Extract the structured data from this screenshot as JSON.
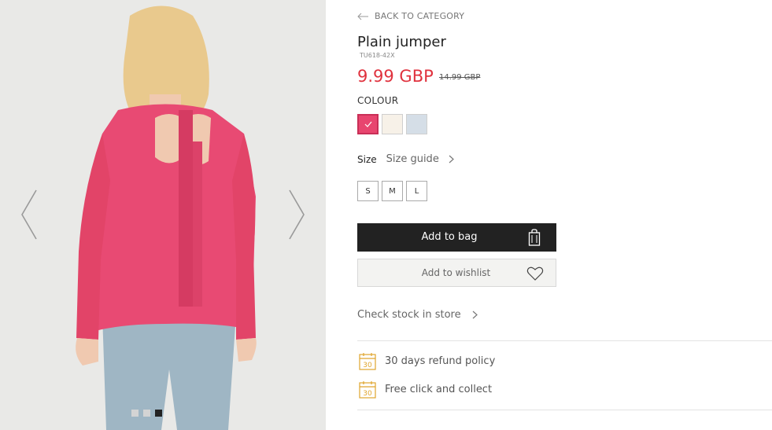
{
  "gallery": {
    "prev_label": "Previous image",
    "next_label": "Next image",
    "dot_count": 3,
    "active_dot": 3
  },
  "product": {
    "back_label": "BACK TO CATEGORY",
    "title": "Plain jumper",
    "sku": "TU618-42X",
    "price": "9.99 GBP",
    "old_price": "14.99 GBP",
    "colour_label": "COLOUR",
    "colours": [
      {
        "name": "pink",
        "hex": "#e8456f",
        "selected": true
      },
      {
        "name": "cream",
        "hex": "#f7f1e8",
        "selected": false
      },
      {
        "name": "light-blue",
        "hex": "#d5dee7",
        "selected": false
      }
    ],
    "size_label": "Size",
    "size_guide_label": "Size guide",
    "sizes": [
      "S",
      "M",
      "L"
    ],
    "add_to_bag_label": "Add to bag",
    "add_to_wishlist_label": "Add to wishlist",
    "check_stock_label": "Check stock in store",
    "perks": [
      "30 days refund policy",
      "Free click and collect"
    ],
    "accent_color": "#e0323e"
  }
}
